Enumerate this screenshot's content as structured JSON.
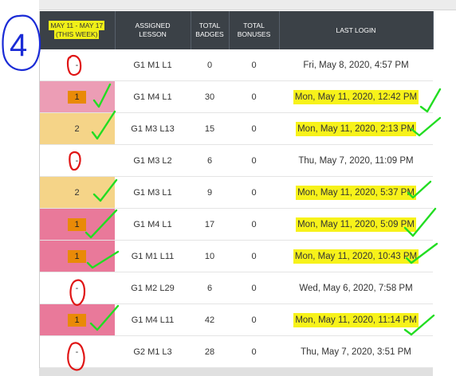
{
  "headers": {
    "week": [
      "May 11 - May 17",
      "(This Week)"
    ],
    "lesson": [
      "Assigned",
      "Lesson"
    ],
    "badges": [
      "Total",
      "Badges"
    ],
    "bonuses": [
      "Total",
      "Bonuses"
    ],
    "login": "Last Login"
  },
  "annotation_number": "4",
  "rows": [
    {
      "week": "-",
      "lesson": "G1 M1 L1",
      "badges": "0",
      "bonuses": "0",
      "login": "Fri, May 8, 2020, 4:57 PM"
    },
    {
      "week": "1",
      "lesson": "G1 M4 L1",
      "badges": "30",
      "bonuses": "0",
      "login": "Mon, May 11, 2020, 12:42 PM"
    },
    {
      "week": "2",
      "lesson": "G1 M3 L13",
      "badges": "15",
      "bonuses": "0",
      "login": "Mon, May 11, 2020, 2:13 PM"
    },
    {
      "week": "-",
      "lesson": "G1 M3 L2",
      "badges": "6",
      "bonuses": "0",
      "login": "Thu, May 7, 2020, 11:09 PM"
    },
    {
      "week": "2",
      "lesson": "G1 M3 L1",
      "badges": "9",
      "bonuses": "0",
      "login": "Mon, May 11, 2020, 5:37 PM"
    },
    {
      "week": "1",
      "lesson": "G1 M4 L1",
      "badges": "17",
      "bonuses": "0",
      "login": "Mon, May 11, 2020, 5:09 PM"
    },
    {
      "week": "1",
      "lesson": "G1 M1 L11",
      "badges": "10",
      "bonuses": "0",
      "login": "Mon, May 11, 2020, 10:43 PM"
    },
    {
      "week": "-",
      "lesson": "G1 M2 L29",
      "badges": "6",
      "bonuses": "0",
      "login": "Wed, May 6, 2020, 7:58 PM"
    },
    {
      "week": "1",
      "lesson": "G1 M4 L11",
      "badges": "42",
      "bonuses": "0",
      "login": "Mon, May 11, 2020, 11:14 PM"
    },
    {
      "week": "-",
      "lesson": "G2 M1 L3",
      "badges": "28",
      "bonuses": "0",
      "login": "Thu, May 7, 2020, 3:51 PM"
    }
  ],
  "colors": {
    "header": "#3b4147",
    "week_text": "#f6ec1f",
    "pink": "#ec9db5",
    "tan": "#f5d488",
    "sticker": "#e98a07",
    "highlight": "#f7f21a",
    "check": "#22dd22",
    "pen_blue": "#1a2bd6",
    "pen_red": "#e01515"
  }
}
